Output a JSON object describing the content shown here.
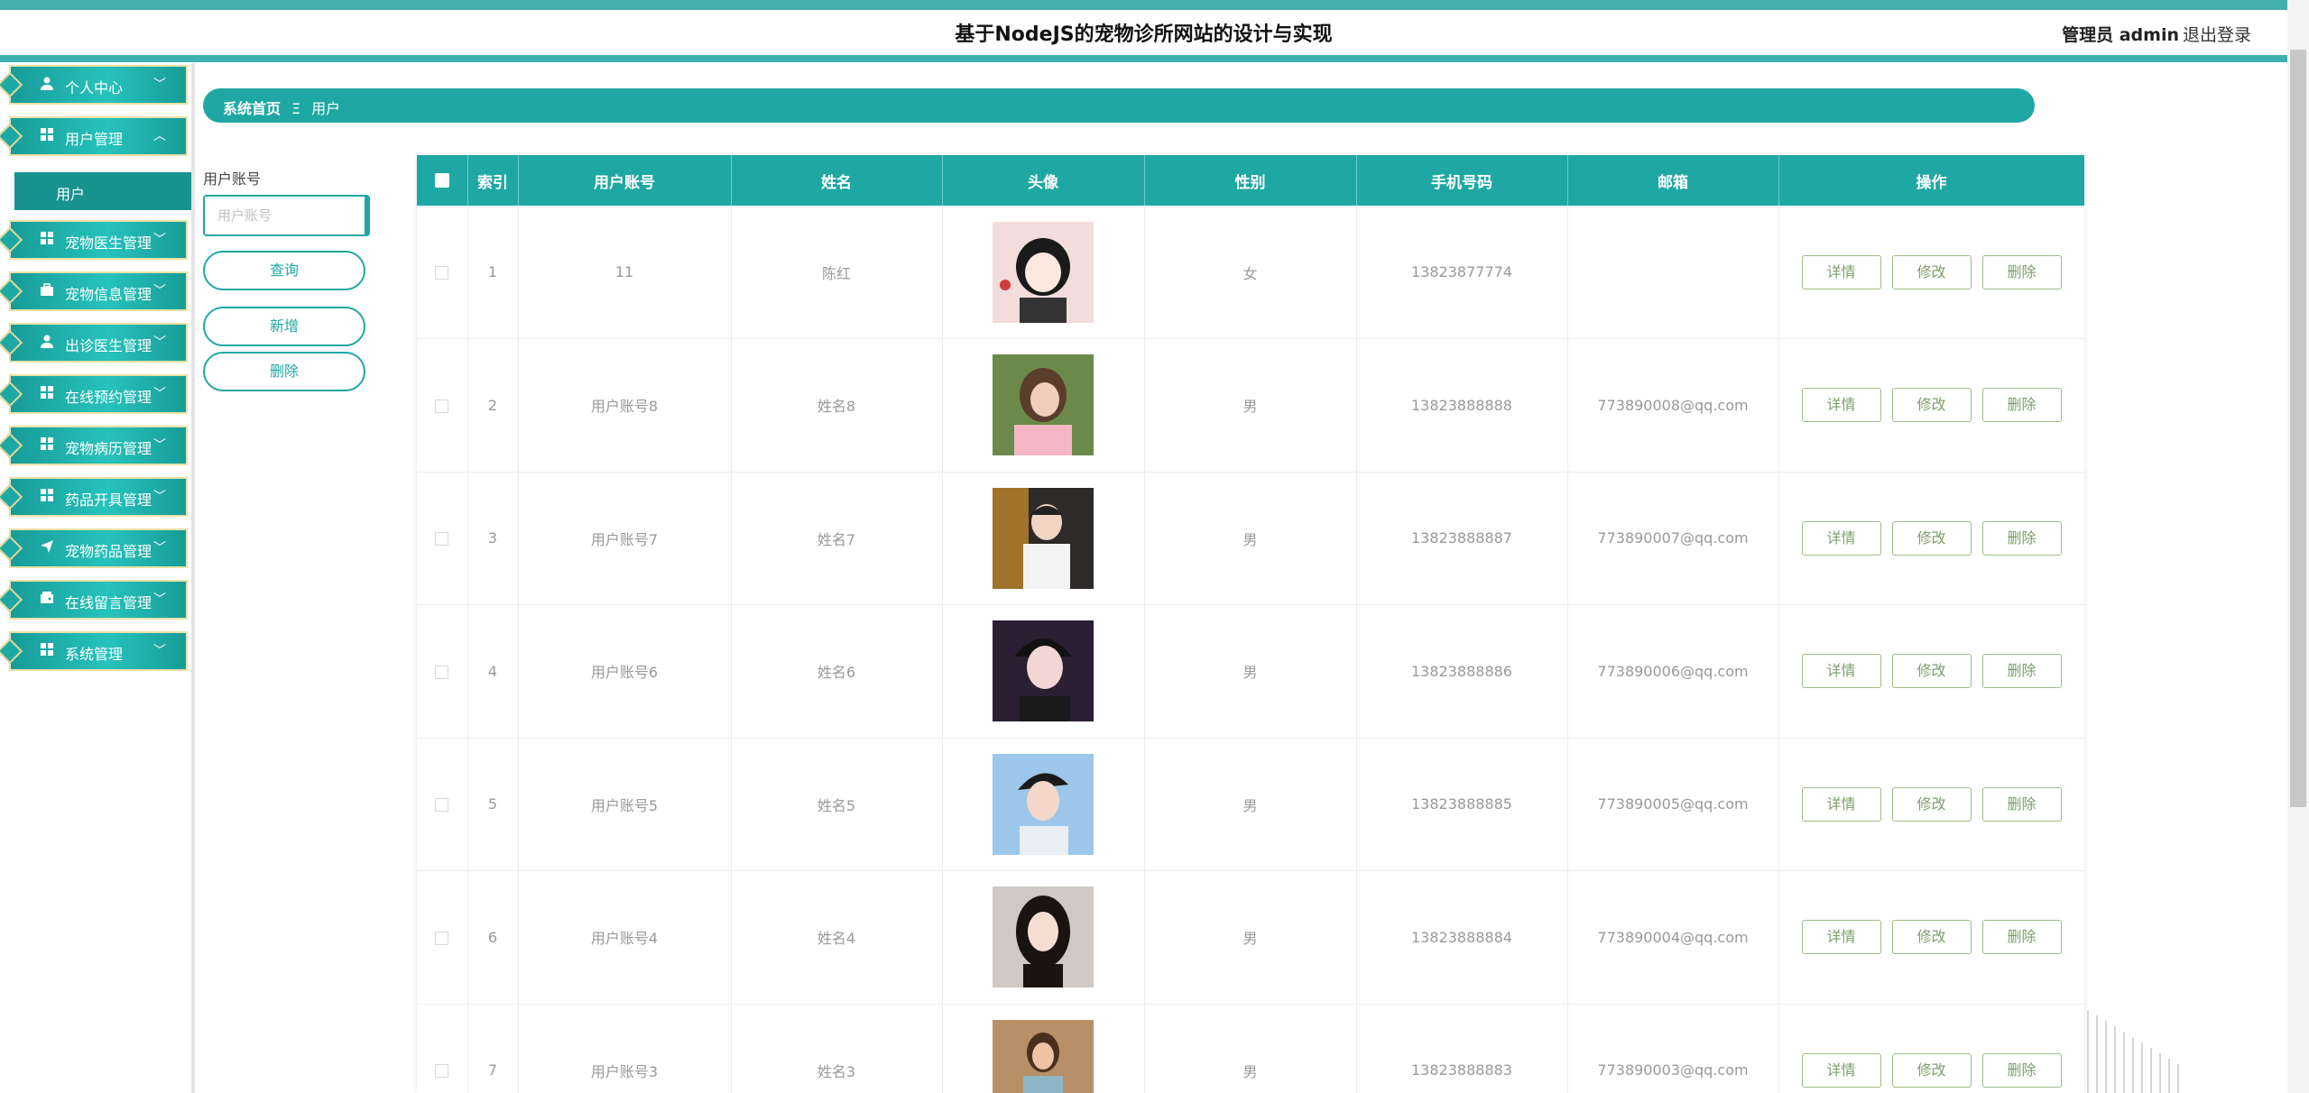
{
  "header": {
    "title": "基于NodeJS的宠物诊所网站的设计与实现",
    "user": "管理员 admin",
    "logout": "退出登录"
  },
  "sidebar": {
    "items": [
      {
        "label": "个人中心",
        "icon": "user-icon"
      },
      {
        "label": "用户管理",
        "icon": "grid-icon"
      },
      {
        "label": "宠物医生管理",
        "icon": "grid-icon"
      },
      {
        "label": "宠物信息管理",
        "icon": "briefcase-icon"
      },
      {
        "label": "出诊医生管理",
        "icon": "user-icon"
      },
      {
        "label": "在线预约管理",
        "icon": "grid-icon"
      },
      {
        "label": "宠物病历管理",
        "icon": "grid-icon"
      },
      {
        "label": "药品开具管理",
        "icon": "grid-icon"
      },
      {
        "label": "宠物药品管理",
        "icon": "send-icon"
      },
      {
        "label": "在线留言管理",
        "icon": "wallet-icon"
      },
      {
        "label": "系统管理",
        "icon": "grid-icon"
      }
    ],
    "sub_item": "用户"
  },
  "breadcrumb": {
    "home": "系统首页",
    "sep": "Ξ",
    "current": "用户"
  },
  "search": {
    "label": "用户账号",
    "placeholder": "用户账号",
    "query_button": "查询",
    "add_button": "新增",
    "delete_button": "删除"
  },
  "table": {
    "headers": [
      "索引",
      "用户账号",
      "姓名",
      "头像",
      "性别",
      "手机号码",
      "邮箱",
      "操作"
    ],
    "actions": {
      "detail": "详情",
      "edit": "修改",
      "delete": "删除"
    },
    "rows": [
      {
        "index": "1",
        "account": "11",
        "name": "陈红",
        "gender": "女",
        "phone": "13823877774",
        "email": ""
      },
      {
        "index": "2",
        "account": "用户账号8",
        "name": "姓名8",
        "gender": "男",
        "phone": "13823888888",
        "email": "773890008@qq.com"
      },
      {
        "index": "3",
        "account": "用户账号7",
        "name": "姓名7",
        "gender": "男",
        "phone": "13823888887",
        "email": "773890007@qq.com"
      },
      {
        "index": "4",
        "account": "用户账号6",
        "name": "姓名6",
        "gender": "男",
        "phone": "13823888886",
        "email": "773890006@qq.com"
      },
      {
        "index": "5",
        "account": "用户账号5",
        "name": "姓名5",
        "gender": "男",
        "phone": "13823888885",
        "email": "773890005@qq.com"
      },
      {
        "index": "6",
        "account": "用户账号4",
        "name": "姓名4",
        "gender": "男",
        "phone": "13823888884",
        "email": "773890004@qq.com"
      },
      {
        "index": "7",
        "account": "用户账号3",
        "name": "姓名3",
        "gender": "男",
        "phone": "13823888883",
        "email": "773890003@qq.com"
      }
    ]
  },
  "colors": {
    "accent": "#1fa8a3",
    "header_band": "#42b1ad",
    "action_border": "#9dbb88"
  }
}
